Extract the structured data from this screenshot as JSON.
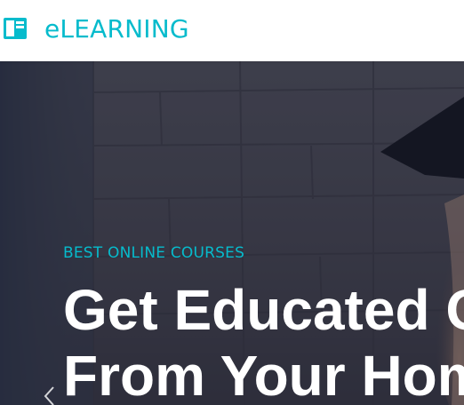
{
  "navbar": {
    "brand_icon": "book-icon",
    "brand_text": "eLEARNING"
  },
  "hero": {
    "subtitle": "BEST ONLINE COURSES",
    "title_line1": "Get Educated O",
    "title_line2": "From Your Hom",
    "prev_icon": "chevron-left-icon"
  },
  "colors": {
    "accent": "#06BBCC",
    "hero_title": "#FFFFFF",
    "overlay": "#181D38"
  }
}
